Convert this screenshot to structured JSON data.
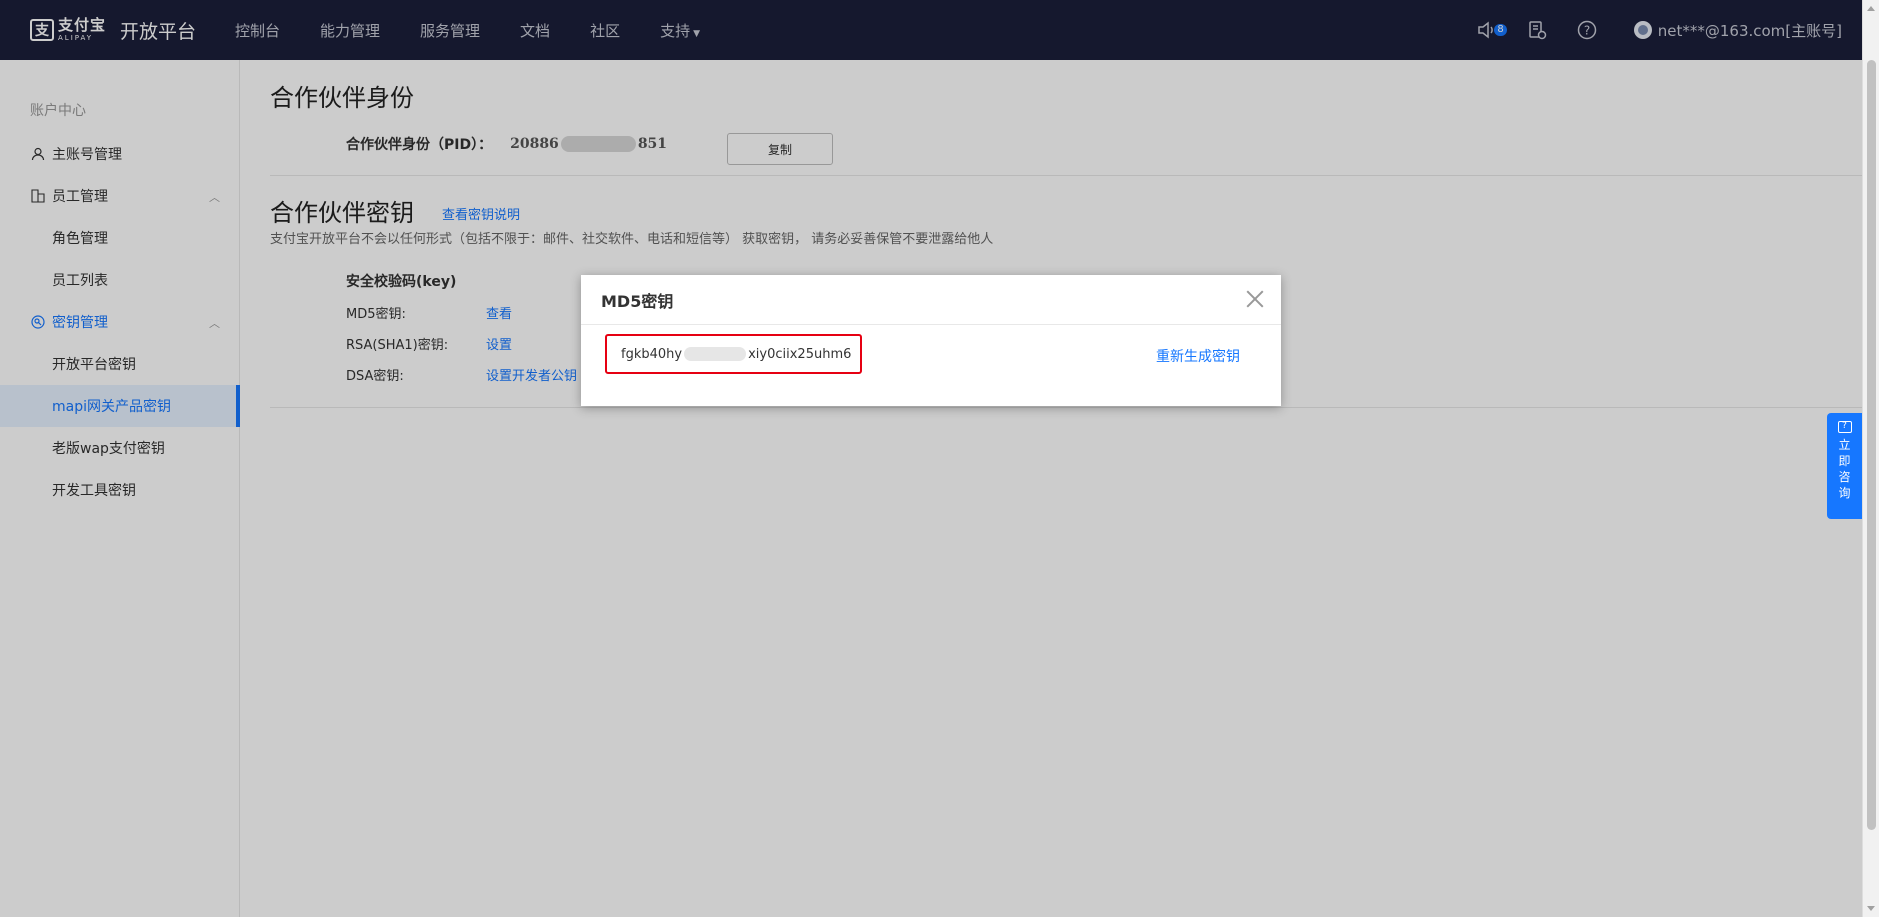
{
  "topbar": {
    "logo_cn": "支付宝",
    "logo_en": "ALIPAY",
    "title": "开放平台",
    "nav": [
      "控制台",
      "能力管理",
      "服务管理",
      "文档",
      "社区",
      "支持"
    ],
    "notification_count": "8",
    "user": "net***@163.com[主账号]"
  },
  "sidebar": {
    "heading": "账户中心",
    "items": [
      {
        "label": "主账号管理",
        "icon": "user-icon"
      },
      {
        "label": "员工管理",
        "icon": "staff-icon"
      },
      {
        "label": "角色管理"
      },
      {
        "label": "员工列表"
      },
      {
        "label": "密钥管理",
        "icon": "key-icon"
      },
      {
        "label": "开放平台密钥"
      },
      {
        "label": "mapi网关产品密钥"
      },
      {
        "label": "老版wap支付密钥"
      },
      {
        "label": "开发工具密钥"
      }
    ]
  },
  "main": {
    "section1_title": "合作伙伴身份",
    "pid_label": "合作伙伴身份（PID）：",
    "pid_prefix": "20886",
    "pid_suffix": "851",
    "copy_button": "复制",
    "section2_title": "合作伙伴密钥",
    "view_key_doc_link": "查看密钥说明",
    "note": "支付宝开放平台不会以任何形式（包括不限于：邮件、社交软件、电话和短信等） 获取密钥， 请务必妥善保管不要泄露给他人",
    "key_section_title": "安全校验码(key)",
    "keys": [
      {
        "label": "MD5密钥:",
        "action": "查看"
      },
      {
        "label": "RSA(SHA1)密钥:",
        "action": "设置"
      },
      {
        "label": "DSA密钥:",
        "action": "设置开发者公钥"
      }
    ]
  },
  "modal": {
    "title": "MD5密钥",
    "key_prefix": "fgkb40hy",
    "key_suffix": "xiy0ciix25uhm6",
    "regenerate_link": "重新生成密钥"
  },
  "consult": {
    "label": "立即咨询"
  },
  "colors": {
    "topbar": "#1b1f3a",
    "accent": "#1677ff",
    "highlight_border": "#e60012"
  }
}
